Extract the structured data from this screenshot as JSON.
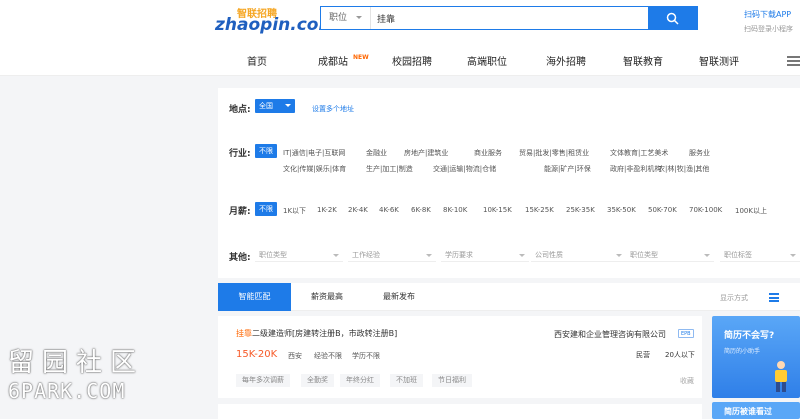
{
  "header": {
    "logo_cn": "智联招聘",
    "logo_en": "zhaopin.com",
    "search_category": "职位",
    "search_value": "挂靠",
    "app_download": "扫码下载APP",
    "app_sub": "扫码登录小程序"
  },
  "nav": {
    "items": [
      "首页",
      "成都站",
      "校园招聘",
      "高端职位",
      "海外招聘",
      "智联教育",
      "智联测评"
    ],
    "new_badge": "NEW"
  },
  "filters": {
    "location_label": "地点:",
    "location_value": "全国",
    "location_more": "设置多个地址",
    "industry_label": "行业:",
    "industry_selected": "不限",
    "industry_options": [
      "IT|通信|电子|互联网",
      "金融业",
      "房地产|建筑业",
      "商业服务",
      "贸易|批发|零售|租赁业",
      "文体教育|工艺美术",
      "服务业",
      "文化|传媒|娱乐|体育",
      "生产|加工|制造",
      "交通|运输|物流|仓储",
      "能源|矿产|环保",
      "政府|非盈利机构",
      "农|林|牧|渔|其他"
    ],
    "salary_label": "月薪:",
    "salary_selected": "不限",
    "salary_options": [
      "1K以下",
      "1K-2K",
      "2K-4K",
      "4K-6K",
      "6K-8K",
      "8K-10K",
      "10K-15K",
      "15K-25K",
      "25K-35K",
      "35K-50K",
      "50K-70K",
      "70K-100K",
      "100K以上"
    ],
    "other_label": "其他:",
    "other_selects": [
      "职位类型",
      "工作经验",
      "学历要求",
      "公司性质",
      "职位类型",
      "职位标签"
    ]
  },
  "tabs": {
    "items": [
      "智能匹配",
      "薪资最高",
      "最新发布"
    ],
    "sort": "显示方式"
  },
  "job": {
    "title_highlight": "挂靠",
    "title_rest": "二级建造师[房建转注册B，市政转注册B]",
    "salary": "15K-20K",
    "city": "西安",
    "experience": "经验不限",
    "education": "学历不限",
    "company": "西安建和企业管理咨询有限公司",
    "company_badge": "EPB",
    "company_type": "民营",
    "company_size": "20人以下",
    "welfare": [
      "每年多次调薪",
      "全勤奖",
      "年终分红",
      "不加班",
      "节日福利"
    ],
    "favorite": "收藏"
  },
  "promo": {
    "title": "简历不会写?",
    "subtitle": "简历的小助手",
    "title2": "简历被谁看过"
  },
  "watermark": {
    "cn": "留园社区",
    "en": "6PARK.COM"
  },
  "colors": {
    "accent": "#1e7be8",
    "salary": "#f65a28",
    "highlight": "#ff6600"
  }
}
